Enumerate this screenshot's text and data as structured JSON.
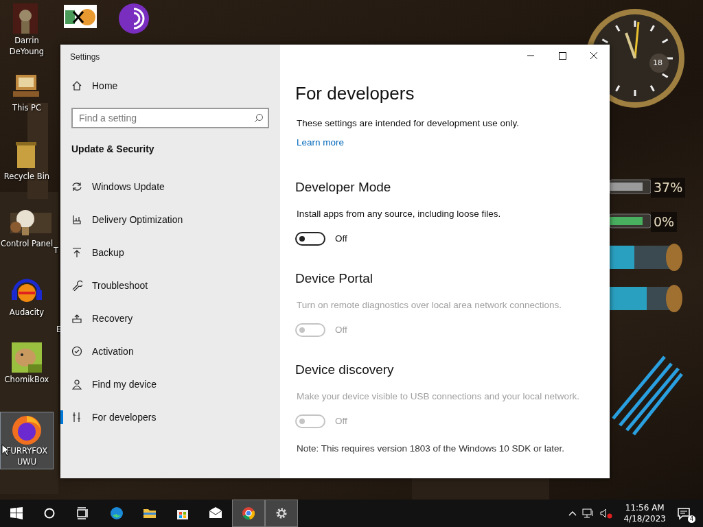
{
  "desktop": {
    "icons": [
      {
        "kind": "bust",
        "label": "Darrin\nDeYoung",
        "selected": false
      },
      {
        "kind": "hxd",
        "selected": false
      },
      {
        "kind": "tor",
        "selected": false
      },
      {
        "kind": "pc",
        "label": "This PC",
        "selected": false
      },
      {
        "kind": "bin",
        "label": "Recycle Bin",
        "selected": false
      },
      {
        "kind": "bulb",
        "label": "Control Panel",
        "selected": false
      },
      {
        "kind": "audacity",
        "label": "Audacity",
        "selected": false
      },
      {
        "kind": "hamster",
        "label": "ChomikBox",
        "selected": false
      },
      {
        "kind": "firefox",
        "label": "FURRYFOX\nUWU",
        "selected": true
      }
    ],
    "cut_labels": [
      "T",
      "E"
    ],
    "clock": {
      "date": "18"
    },
    "gauges": [
      {
        "reading": "37%",
        "color": "#9a9a9a"
      },
      {
        "reading": "0%",
        "color": "#49b060"
      }
    ]
  },
  "window": {
    "title": "Settings",
    "sidebar": {
      "home": "Home",
      "search": {
        "placeholder": "Find a setting"
      },
      "section": "Update & Security",
      "items": [
        {
          "kind": "refresh",
          "label": "Windows Update",
          "selected": false
        },
        {
          "kind": "delivery",
          "label": "Delivery Optimization",
          "selected": false
        },
        {
          "kind": "backup",
          "label": "Backup",
          "selected": false
        },
        {
          "kind": "wrench",
          "label": "Troubleshoot",
          "selected": false
        },
        {
          "kind": "recovery",
          "label": "Recovery",
          "selected": false
        },
        {
          "kind": "check",
          "label": "Activation",
          "selected": false
        },
        {
          "kind": "find",
          "label": "Find my device",
          "selected": false
        },
        {
          "kind": "dev",
          "label": "For developers",
          "selected": true
        }
      ]
    },
    "content": {
      "heading": "For developers",
      "intro": "These settings are intended for development use only.",
      "link": "Learn more",
      "sections": [
        {
          "title": "Developer Mode",
          "description": "Install apps from any source, including loose files.",
          "toggle": {
            "on": false,
            "disabled": false,
            "label": "Off"
          }
        },
        {
          "title": "Device Portal",
          "description": "Turn on remote diagnostics over local area network connections.",
          "toggle": {
            "on": false,
            "disabled": true,
            "label": "Off"
          }
        },
        {
          "title": "Device discovery",
          "description": "Make your device visible to USB connections and your local network.",
          "toggle": {
            "on": false,
            "disabled": true,
            "label": "Off"
          }
        }
      ],
      "note": "Note: This requires version 1803 of the Windows 10 SDK or later."
    }
  },
  "taskbar": {
    "apps": [
      {
        "kind": "start",
        "open": false
      },
      {
        "kind": "search",
        "open": false
      },
      {
        "kind": "taskview",
        "open": false
      },
      {
        "kind": "edge",
        "open": false
      },
      {
        "kind": "explorer",
        "open": false
      },
      {
        "kind": "store",
        "open": false
      },
      {
        "kind": "mail",
        "open": false
      },
      {
        "kind": "chrome",
        "open": true
      },
      {
        "kind": "settings",
        "open": true
      }
    ],
    "time": "11:56 AM",
    "date": "4/18/2023",
    "notifications": "4"
  }
}
